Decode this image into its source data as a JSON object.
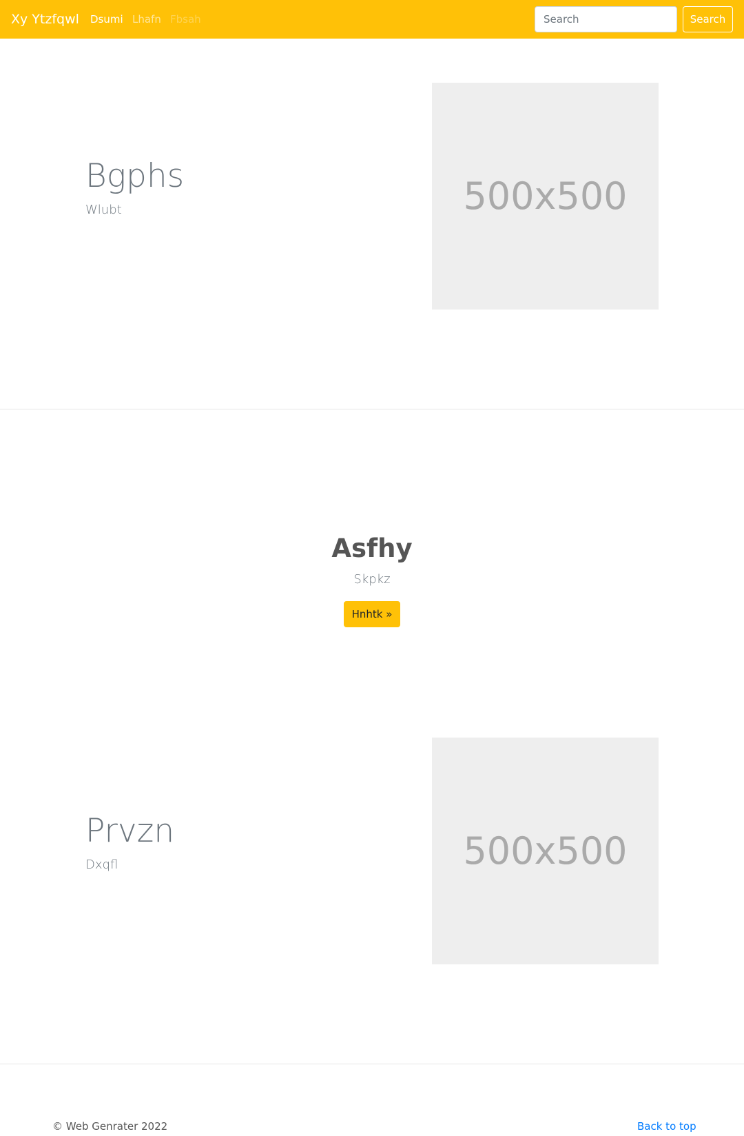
{
  "navbar": {
    "brand": "Xy Ytzfqwl",
    "links": [
      {
        "label": "Dsumi",
        "state": "active"
      },
      {
        "label": "Lhafn",
        "state": "normal"
      },
      {
        "label": "Fbsah",
        "state": "disabled"
      }
    ],
    "search": {
      "placeholder": "Search",
      "value": "",
      "button_label": "Search"
    },
    "color": "#ffc107"
  },
  "feature1": {
    "heading": "Bgphs",
    "lead": "Wlubt",
    "image_label": "500x500"
  },
  "center": {
    "heading": "Asfhy",
    "subheading": "Skpkz",
    "button_label": "Hnhtk »"
  },
  "feature2": {
    "heading": "Prvzn",
    "lead": "Dxqfl",
    "image_label": "500x500"
  },
  "footer": {
    "copyright": "© Web Genrater 2022",
    "back_to_top": "Back to top",
    "link_color": "#007bff"
  }
}
